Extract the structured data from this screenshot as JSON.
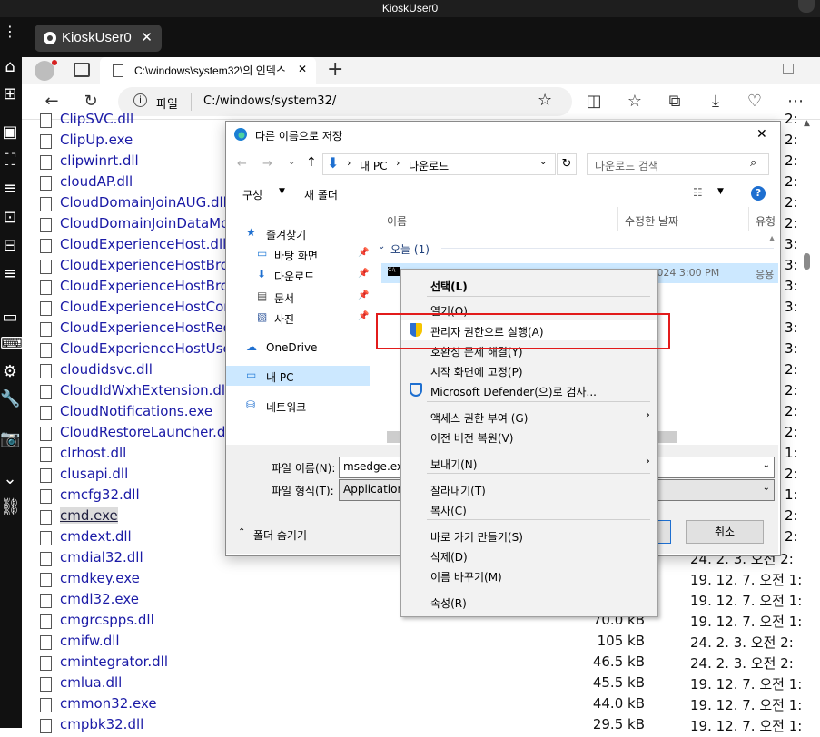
{
  "kiosk": {
    "title": "KioskUser0",
    "tab_label": "KioskUser0",
    "tab_close": "✕"
  },
  "browser": {
    "tab_title": "C:\\windows\\system32\\의 인덱스",
    "tab_close": "✕",
    "new_tab": "+",
    "address_prefix": "파일",
    "address_url": "C:/windows/system32/"
  },
  "files": [
    {
      "name": "ClipSVC.dll",
      "size": "",
      "date": ""
    },
    {
      "name": "ClipUp.exe",
      "size": "",
      "date": ""
    },
    {
      "name": "clipwinrt.dll",
      "size": "",
      "date": ""
    },
    {
      "name": "cloudAP.dll",
      "size": "",
      "date": ""
    },
    {
      "name": "CloudDomainJoinAUG.dll",
      "size": "",
      "date": ""
    },
    {
      "name": "CloudDomainJoinDataMo",
      "size": "",
      "date": ""
    },
    {
      "name": "CloudExperienceHost.dll",
      "size": "",
      "date": ""
    },
    {
      "name": "CloudExperienceHostBro",
      "size": "",
      "date": ""
    },
    {
      "name": "CloudExperienceHostBro",
      "size": "",
      "date": ""
    },
    {
      "name": "CloudExperienceHostCor",
      "size": "",
      "date": ""
    },
    {
      "name": "CloudExperienceHostRed",
      "size": "",
      "date": ""
    },
    {
      "name": "CloudExperienceHostUse",
      "size": "",
      "date": ""
    },
    {
      "name": "cloudidsvc.dll",
      "size": "",
      "date": ""
    },
    {
      "name": "CloudIdWxhExtension.dll",
      "size": "",
      "date": ""
    },
    {
      "name": "CloudNotifications.exe",
      "size": "",
      "date": ""
    },
    {
      "name": "CloudRestoreLauncher.dll",
      "size": "",
      "date": ""
    },
    {
      "name": "clrhost.dll",
      "size": "",
      "date": ""
    },
    {
      "name": "clusapi.dll",
      "size": "",
      "date": ""
    },
    {
      "name": "cmcfg32.dll",
      "size": "",
      "date": ""
    },
    {
      "name": "cmd.exe",
      "size": "",
      "date": ""
    },
    {
      "name": "cmdext.dll",
      "size": "",
      "date": ""
    },
    {
      "name": "cmdial32.dll",
      "size": "",
      "date": "24. 2. 3. 오전 2:"
    },
    {
      "name": "cmdkey.exe",
      "size": "",
      "date": "19. 12. 7. 오전 1:"
    },
    {
      "name": "cmdl32.exe",
      "size": "",
      "date": "19. 12. 7. 오전 1:"
    },
    {
      "name": "cmgrcspps.dll",
      "size": "70.0 kB",
      "date": "19. 12. 7. 오전 1:"
    },
    {
      "name": "cmifw.dll",
      "size": "105 kB",
      "date": "24. 2. 3. 오전 2:"
    },
    {
      "name": "cmintegrator.dll",
      "size": "46.5 kB",
      "date": "24. 2. 3. 오전 2:"
    },
    {
      "name": "cmlua.dll",
      "size": "45.5 kB",
      "date": "19. 12. 7. 오전 1:"
    },
    {
      "name": "cmmon32.exe",
      "size": "44.0 kB",
      "date": "19. 12. 7. 오전 1:"
    },
    {
      "name": "cmpbk32.dll",
      "size": "29.5 kB",
      "date": "19. 12. 7. 오전 1:"
    }
  ],
  "right_col_chars": [
    "2:",
    "2:",
    "2:",
    "2:",
    "2:",
    "2:",
    "3:",
    "3:",
    "3:",
    "3:",
    "3:",
    "3:",
    "2:",
    "2:",
    "2:",
    "2:",
    "1:",
    "2:",
    "1:",
    "2:",
    "2:"
  ],
  "dialog": {
    "title": "다른 이름으로 저장",
    "close": "✕",
    "breadcrumb": [
      "내 PC",
      "다운로드"
    ],
    "search_placeholder": "다운로드 검색",
    "organize": "구성",
    "new_folder": "새 폴더",
    "nav": [
      {
        "label": "즐겨찾기",
        "pin": false
      },
      {
        "label": "바탕 화면",
        "pin": true
      },
      {
        "label": "다운로드",
        "pin": true
      },
      {
        "label": "문서",
        "pin": true
      },
      {
        "label": "사진",
        "pin": true
      },
      {
        "label": "OneDrive",
        "pin": false
      },
      {
        "label": "내 PC",
        "pin": false
      },
      {
        "label": "네트워크",
        "pin": false
      }
    ],
    "columns": {
      "name": "이름",
      "modified": "수정한 날짜",
      "type": "유형"
    },
    "group": "오늘 (1)",
    "file_row": {
      "date": "9/16/2024 3:00 PM",
      "type": "응용"
    },
    "filename_label": "파일 이름(N):",
    "filename_value": "msedge.exe",
    "filetype_label": "파일 형식(T):",
    "filetype_value": "Application",
    "hide_folders": "폴더 숨기기",
    "cancel": "취소"
  },
  "context_menu": {
    "items": [
      {
        "label": "선택(L)",
        "bold": true
      },
      {
        "label": "열기(O)"
      },
      {
        "label": "관리자 권한으로 실행(A)",
        "icon": "shield-icon"
      },
      {
        "label": "호환성 문제 해결(Y)"
      },
      {
        "label": "시작 화면에 고정(P)"
      },
      {
        "label": "Microsoft Defender(으)로 검사...",
        "icon": "defender-icon"
      },
      {
        "label": "액세스 권한 부여 (G)",
        "submenu": true
      },
      {
        "label": "이전 버전 복원(V)"
      },
      {
        "label": "보내기(N)",
        "submenu": true
      },
      {
        "label": "잘라내기(T)"
      },
      {
        "label": "복사(C)"
      },
      {
        "label": "바로 가기 만들기(S)"
      },
      {
        "label": "삭제(D)"
      },
      {
        "label": "이름 바꾸기(M)"
      },
      {
        "label": "속성(R)"
      }
    ]
  },
  "colors": {
    "highlight_border": "#e21b1b",
    "link": "#1a1aa6",
    "selection": "#cce8ff"
  }
}
